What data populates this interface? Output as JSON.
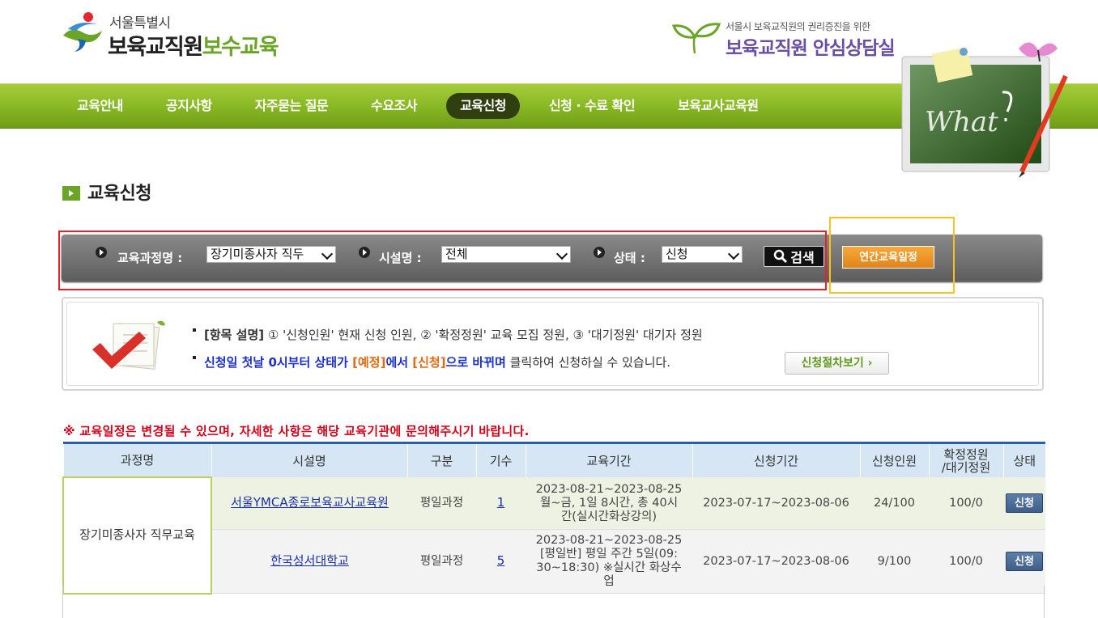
{
  "header": {
    "logo_sub": "서울특별시",
    "logo_main_dark": "보육교직원",
    "logo_main_green": "보수교육",
    "counsel_sub": "서울시 보육교직원의 권리증진을 위한",
    "counsel_main": "보육교직원 안심상담실"
  },
  "nav": {
    "items": [
      "교육안내",
      "공지사항",
      "자주묻는 질문",
      "수요조사",
      "교육신청",
      "신청 · 수료 확인",
      "보육교사교육원"
    ],
    "active": "교육신청"
  },
  "page_title": "교육신청",
  "search": {
    "course_label": "교육과정명 :",
    "course_value": "장기미종사자 직두",
    "facility_label": "시설명 :",
    "facility_value": "전체",
    "status_label": "상태 :",
    "status_value": "신청",
    "search_button": "검색",
    "annual_button": "연간교육일정"
  },
  "info": {
    "line1_prefix": "[항목 설명]",
    "line1_text": " ① '신청인원' 현재 신청 인원, ② '확정정원' 교육 모집 정원, ③ '대기정원' 대기자 정원",
    "line2_a": "신청일 첫날 0시부터 상태가 ",
    "line2_b": "[예정]",
    "line2_c": "에서 ",
    "line2_d": "[신청]",
    "line2_e": "으로 바뀌며",
    "line2_f": " 클릭하여 신청하실 수 있습니다.",
    "procedure_button": "신청절차보기 ›"
  },
  "notice": "※ 교육일정은 변경될 수 있으며, 자세한 사항은 해당 교육기관에 문의해주시기 바랍니다.",
  "table": {
    "headers": [
      "과정명",
      "시설명",
      "구분",
      "기수",
      "교육기간",
      "신청기간",
      "신청인원",
      "확정정원/대기정원",
      "상태"
    ],
    "header_quota_line1": "확정정원",
    "header_quota_line2": "/대기정원",
    "course_name": "장기미종사자 직무교육",
    "rows": [
      {
        "facility": "서울YMCA종로보육교사교육원",
        "type": "평일과정",
        "term": "1",
        "period_line1": "2023-08-21~2023-08-25",
        "period_line2": "월~금, 1일 8시간, 총 40시",
        "period_line3": "간(실시간화상강의)",
        "apply_period": "2023-07-17~2023-08-06",
        "applicants": "24/100",
        "quota": "100/0",
        "status": "신청"
      },
      {
        "facility": "한국성서대학교",
        "type": "평일과정",
        "term": "5",
        "period_line1": "2023-08-21~2023-08-25",
        "period_line2": "[평일반] 평일 주간 5일(09:",
        "period_line3": "30~18:30) ※실시간 화상수",
        "period_line4": "업",
        "apply_period": "2023-07-17~2023-08-06",
        "applicants": "9/100",
        "quota": "100/0",
        "status": "신청"
      }
    ]
  },
  "colors": {
    "nav_green": "#8cbb27",
    "active_tab": "#2f3f10",
    "notice_red": "#d4001a",
    "annual_orange": "#e1831a",
    "highlight_red": "#e62127",
    "highlight_yellow": "#f7c21a"
  }
}
